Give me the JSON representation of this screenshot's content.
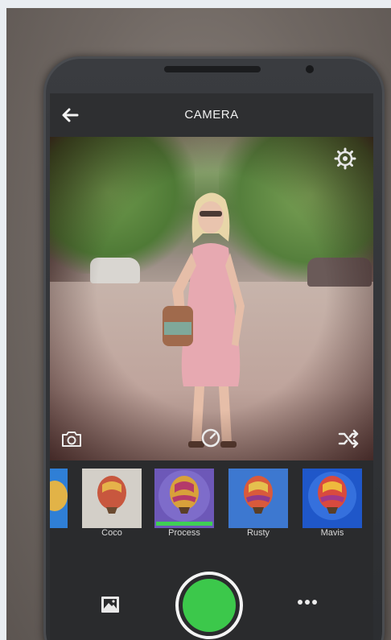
{
  "app": {
    "title": "CAMERA"
  },
  "colors": {
    "accent_green": "#3cc84b",
    "selection_bar": "#3fcf55",
    "bar_background": "#2a2b2d",
    "text": "#f1f1f1"
  },
  "icons": {
    "back": "arrow-left-icon",
    "settings": "gear-icon",
    "switch_camera": "camera-switch-icon",
    "timer": "timer-icon",
    "shuffle": "shuffle-icon",
    "gallery": "gallery-icon",
    "more": "more-dots-icon"
  },
  "filters": [
    {
      "label": "",
      "selected": false
    },
    {
      "label": "Coco",
      "selected": false
    },
    {
      "label": "Process",
      "selected": true
    },
    {
      "label": "Rusty",
      "selected": false
    },
    {
      "label": "Mavis",
      "selected": false
    }
  ]
}
